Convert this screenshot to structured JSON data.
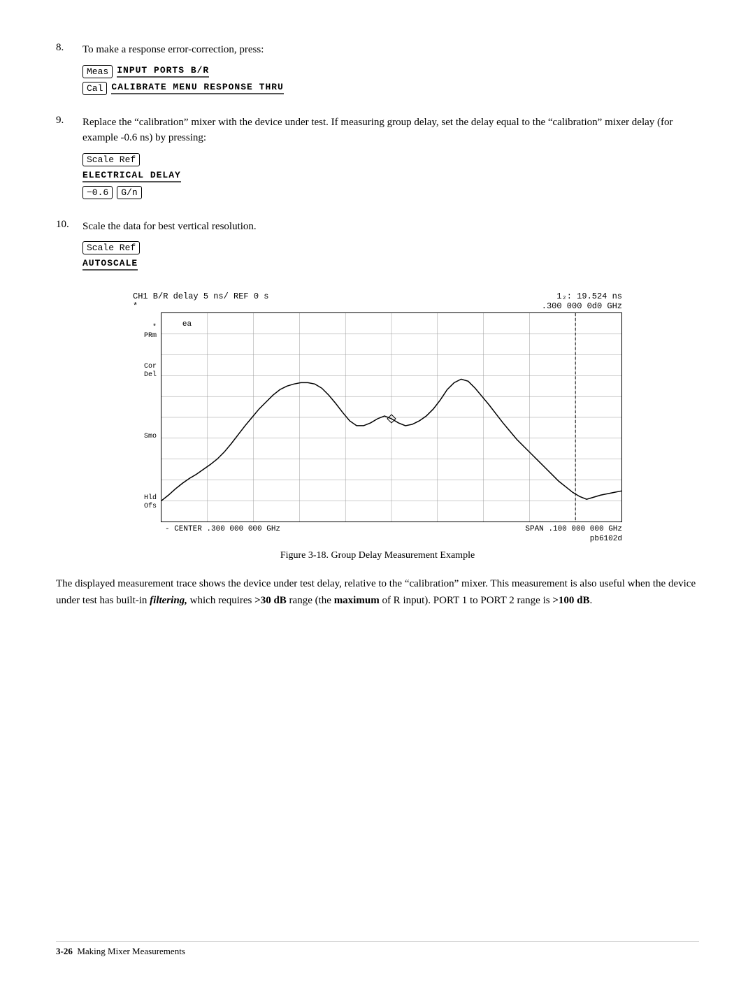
{
  "steps": [
    {
      "number": "8.",
      "text": "To make a response error-correction, press:",
      "key_rows": [
        [
          {
            "type": "btn",
            "text": "Meas"
          },
          {
            "type": "label",
            "text": "INPUT PORTS  B/R"
          }
        ],
        [
          {
            "type": "btn",
            "text": "Cal"
          },
          {
            "type": "label",
            "text": "CALIBRATE  MENU  RESPONSE  THRU"
          }
        ]
      ]
    },
    {
      "number": "9.",
      "text": "Replace the “calibration” mixer with the device under test. If measuring group delay, set the delay equal to the “calibration” mixer delay (for example -0.6 ns) by pressing:",
      "key_rows": [
        [
          {
            "type": "btn",
            "text": "Scale Ref"
          }
        ],
        [
          {
            "type": "label",
            "text": "ELECTRICAL DELAY"
          }
        ],
        [
          {
            "type": "btn",
            "text": "−0.6"
          },
          {
            "type": "btn",
            "text": "G/n"
          }
        ]
      ]
    },
    {
      "number": "10.",
      "text": "Scale the data for best vertical resolution.",
      "key_rows": [
        [
          {
            "type": "btn",
            "text": "Scale Ref"
          }
        ],
        [
          {
            "type": "label",
            "text": "AUTOSCALE"
          }
        ]
      ]
    }
  ],
  "chart": {
    "header_left_line1": "CH1  B/R delay          5 ns/  REF  0   s",
    "header_left_line2": "  *",
    "header_right_line1": "1₂:  19.524 ns",
    "header_right_line2": "  .300 000 0d0 GHz",
    "y_labels": [
      "PRm",
      "Cor",
      "Del",
      "",
      "Smo",
      "",
      "Hld",
      "Ofs"
    ],
    "footer_left": "- CENTER  .300 000 000 GHz",
    "footer_right": "SPAN .100 000 000 GHz",
    "ref_code": "pb6102d"
  },
  "figure_caption": "Figure 3-18.  Group Delay Measurement Example",
  "body_paragraphs": [
    {
      "text_parts": [
        {
          "text": "The displayed measurement trace shows the device under test delay, relative to the “calibration” mixer. This measurement is also useful when the device under test has built-in ",
          "style": "normal"
        },
        {
          "text": "filtering,",
          "style": "bold-italic"
        },
        {
          "text": " which requires ",
          "style": "normal"
        },
        {
          "text": ">30 dB",
          "style": "bold"
        },
        {
          "text": " range (the ",
          "style": "normal"
        },
        {
          "text": "maximum",
          "style": "bold"
        },
        {
          "text": " of R input). PORT 1 to PORT 2 range is ",
          "style": "normal"
        },
        {
          "text": ">100 dB",
          "style": "bold"
        },
        {
          "text": ".",
          "style": "normal"
        }
      ]
    }
  ],
  "footer": {
    "page_ref": "3-26",
    "text": "Making  Mixer  Measurements"
  }
}
